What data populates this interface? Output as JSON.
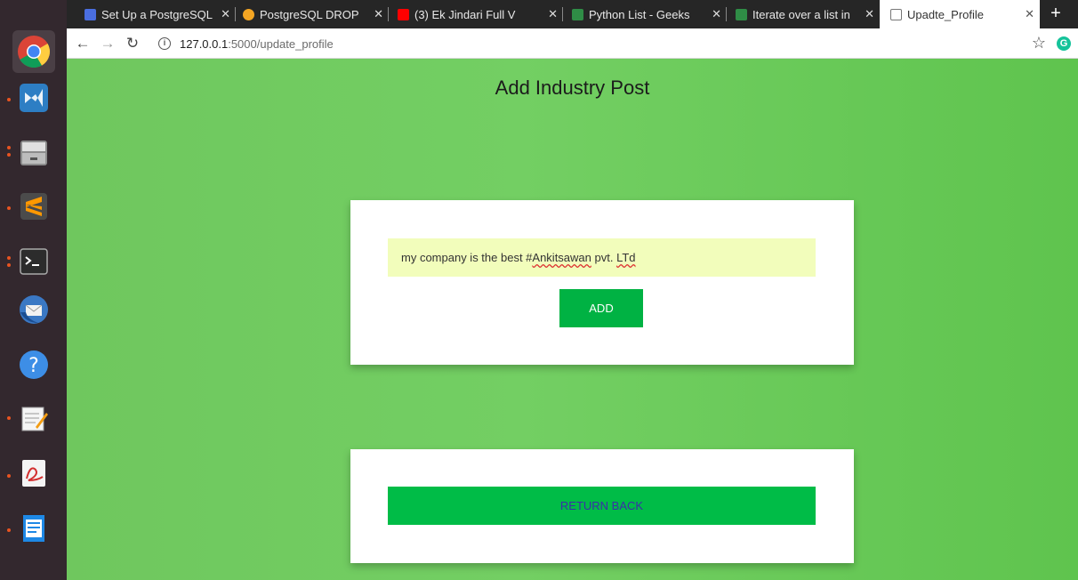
{
  "tabs": [
    {
      "title": "Set Up a PostgreSQL",
      "favicon_color": "#4a6ee0"
    },
    {
      "title": "PostgreSQL DROP",
      "favicon_color": "#f5a623"
    },
    {
      "title": "(3) Ek Jindari Full V",
      "favicon_color": "#ff0000"
    },
    {
      "title": "Python List - Geeks",
      "favicon_color": "#2f8d46"
    },
    {
      "title": "Iterate over a list in",
      "favicon_color": "#2f8d46"
    },
    {
      "title": "Upadte_Profile",
      "favicon_color": "#ffffff",
      "active": true
    }
  ],
  "toolbar": {
    "url_host": "127.0.0.1",
    "url_path": ":5000/update_profile"
  },
  "page": {
    "title": "Add Industry Post",
    "post_text_before": "my company is the best #",
    "post_text_misspelled_1": "Ankitsawan",
    "post_text_middle": " pvt. ",
    "post_text_misspelled_2": "LTd",
    "add_label": "ADD",
    "return_label": "RETURN BACK"
  },
  "colors": {
    "background_green": "#6fc75e",
    "button_green": "#00b243",
    "input_bg": "#f2fdbb",
    "return_text": "#3a2fa8"
  },
  "dock_icons": [
    "chrome-icon",
    "vscode-icon",
    "file-manager-icon",
    "sublime-text-icon",
    "terminal-icon",
    "thunderbird-icon",
    "help-icon",
    "text-editor-icon",
    "pdf-viewer-icon",
    "writer-icon"
  ]
}
